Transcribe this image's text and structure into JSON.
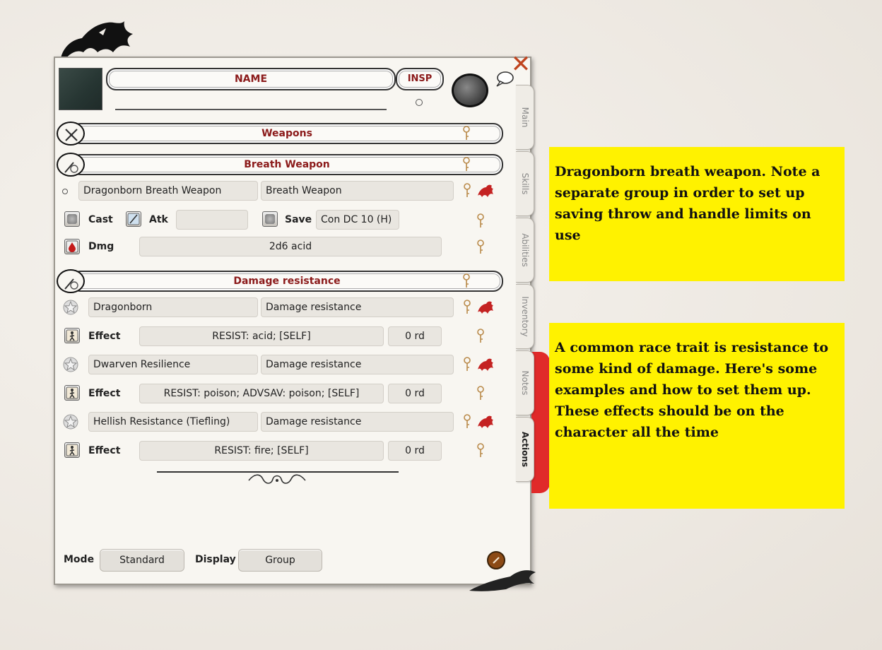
{
  "sheet": {
    "name_label": "NAME",
    "insp_label": "INSP",
    "close_glyph": "✕",
    "icons": {
      "close": "close-x-icon",
      "chat": "speech-bubble-icon",
      "token": "token-circle-icon",
      "portrait": "portrait-image"
    }
  },
  "groups": [
    {
      "label": "Weapons",
      "icon": "crossed-swords-icon"
    },
    {
      "label": "Breath Weapon",
      "icon": "wand-clock-icon"
    },
    {
      "label": "Damage resistance",
      "icon": "wand-clock-icon"
    }
  ],
  "breath_weapon": {
    "name": "Dragonborn Breath Weapon",
    "group": "Breath Weapon",
    "cast_label": "Cast",
    "atk_label": "Atk",
    "atk_value": "",
    "save_label": "Save",
    "save_value": "Con DC 10 (H)",
    "dmg_label": "Dmg",
    "dmg_value": "2d6 acid"
  },
  "resistances": [
    {
      "name": "Dragonborn",
      "group": "Damage resistance",
      "effect_label": "Effect",
      "effect": "RESIST: acid; [SELF]",
      "duration": "0 rd"
    },
    {
      "name": "Dwarven Resilience",
      "group": "Damage resistance",
      "effect_label": "Effect",
      "effect": "RESIST: poison; ADVSAV: poison; [SELF]",
      "duration": "0 rd"
    },
    {
      "name": "Hellish Resistance (Tiefling)",
      "group": "Damage resistance",
      "effect_label": "Effect",
      "effect": "RESIST: fire; [SELF]",
      "duration": "0 rd"
    }
  ],
  "footer": {
    "mode_label": "Mode",
    "mode_value": "Standard",
    "display_label": "Display",
    "display_value": "Group"
  },
  "tabs": [
    {
      "label": "Main",
      "active": false
    },
    {
      "label": "Skills",
      "active": false
    },
    {
      "label": "Abilities",
      "active": false
    },
    {
      "label": "Inventory",
      "active": false
    },
    {
      "label": "Notes",
      "active": false
    },
    {
      "label": "Actions",
      "active": true
    }
  ],
  "notes": [
    {
      "text": "Dragonborn breath weapon. Note a separate group in order to set up saving throw and handle limits on use"
    },
    {
      "text": "A common race trait is resistance to some kind of damage. Here's some examples and how to set them up. These effects should be on the character all the time"
    }
  ],
  "colors": {
    "accent_red": "#8b1a1a",
    "note_yellow": "#fff200",
    "tab_marker": "#e02a2a",
    "close": "#c0441f"
  }
}
